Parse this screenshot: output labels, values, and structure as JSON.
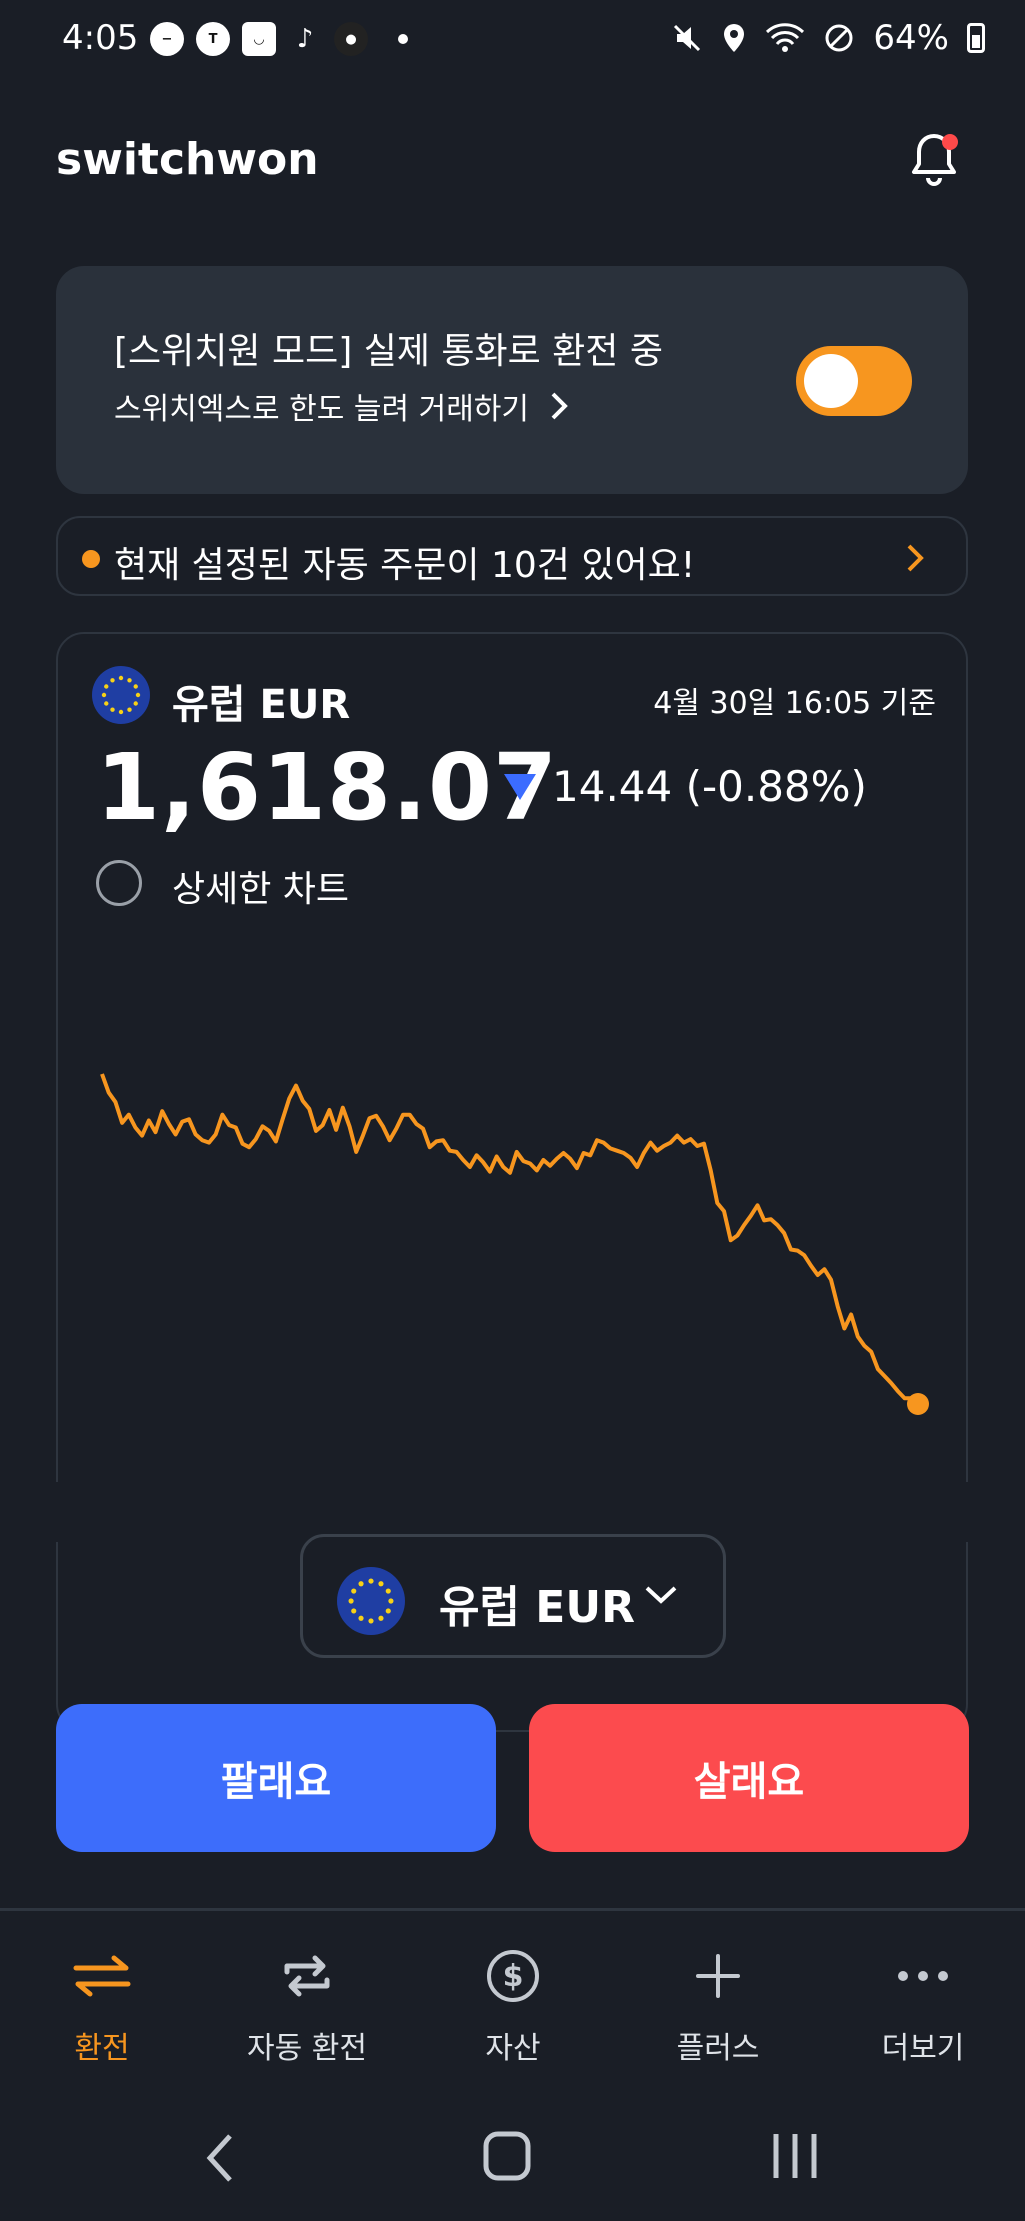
{
  "status_bar": {
    "time": "4:05",
    "battery": "64%",
    "left_icons": [
      "minus-circle-icon",
      "kakaotalk-icon",
      "shopping-bag-icon",
      "tiktok-icon",
      "avatar-icon"
    ]
  },
  "header": {
    "logo": "switchwon",
    "notification_has_badge": true
  },
  "mode_card": {
    "title": "[스위치원 모드] 실제 통화로 환전 중",
    "subtitle": "스위치엑스로 한도 늘려 거래하기",
    "toggle_on": true
  },
  "auto_banner": {
    "text": "현재 설정된 자동 주문이 10건 있어요!"
  },
  "rate_card": {
    "currency": "유럽 EUR",
    "timestamp": "4월 30일 16:05 기준",
    "price": "1,618.07",
    "change": "14.44 (-0.88%)",
    "direction": "down",
    "detail_toggle_label": "상세한 차트"
  },
  "chart_data": {
    "type": "line",
    "series": [
      {
        "values": [
          1632.6,
          1631.0,
          1630.2,
          1628.4,
          1629.1,
          1628.0,
          1627.3,
          1628.6,
          1627.6,
          1629.4,
          1628.3,
          1627.4,
          1628.5,
          1628.7,
          1627.4,
          1626.9,
          1626.7,
          1627.4,
          1629.1,
          1628.2,
          1628.0,
          1626.6,
          1626.3,
          1627.0,
          1628.1,
          1627.7,
          1626.8,
          1628.7,
          1630.5,
          1631.6,
          1630.3,
          1629.6,
          1627.7,
          1628.2,
          1629.5,
          1627.8,
          1629.7,
          1628.1,
          1625.9,
          1627.3,
          1628.8,
          1629.0,
          1628.1,
          1626.9,
          1627.9,
          1629.1,
          1629.1,
          1628.3,
          1627.9,
          1626.3,
          1626.8,
          1626.9,
          1626.0,
          1625.9,
          1625.2,
          1624.6,
          1625.6,
          1625.0,
          1624.2,
          1625.5,
          1624.6,
          1624.1,
          1625.9,
          1625.1,
          1624.9,
          1624.3,
          1625.2,
          1624.7,
          1625.3,
          1625.8,
          1625.3,
          1624.5,
          1625.8,
          1625.6,
          1626.9,
          1626.7,
          1626.2,
          1626.0,
          1625.8,
          1625.4,
          1624.6,
          1625.8,
          1626.7,
          1626.0,
          1626.4,
          1626.7,
          1627.3,
          1626.7,
          1627.0,
          1626.4,
          1626.6,
          1624.3,
          1621.5,
          1620.8,
          1618.3,
          1618.7,
          1619.6,
          1620.4,
          1621.3,
          1620.0,
          1620.1,
          1619.6,
          1618.9,
          1617.5,
          1617.4,
          1617.0,
          1616.1,
          1615.3,
          1615.8,
          1614.9,
          1612.6,
          1610.7,
          1611.9,
          1610.0,
          1609.2,
          1608.7,
          1607.2,
          1606.6,
          1606.0,
          1605.3,
          1604.7,
          1604.7,
          1604.2
        ]
      }
    ],
    "line_color": "#f7961f",
    "grid": false,
    "axes_visible": false
  },
  "selector": {
    "currency": "유럽 EUR"
  },
  "actions": {
    "sell": "팔래요",
    "buy": "살래요"
  },
  "bottom_nav": {
    "items": [
      {
        "label": "환전",
        "icon": "exchange-arrows-icon",
        "active": true
      },
      {
        "label": "자동 환전",
        "icon": "repeat-icon",
        "active": false
      },
      {
        "label": "자산",
        "icon": "dollar-circle-icon",
        "active": false
      },
      {
        "label": "플러스",
        "icon": "plus-icon",
        "active": false
      },
      {
        "label": "더보기",
        "icon": "more-dots-icon",
        "active": false
      }
    ]
  },
  "colors": {
    "background": "#1a1e26",
    "accent": "#f7961f",
    "sell": "#3d6dfb",
    "buy": "#fc4b4e",
    "down": "#3b6cff"
  }
}
